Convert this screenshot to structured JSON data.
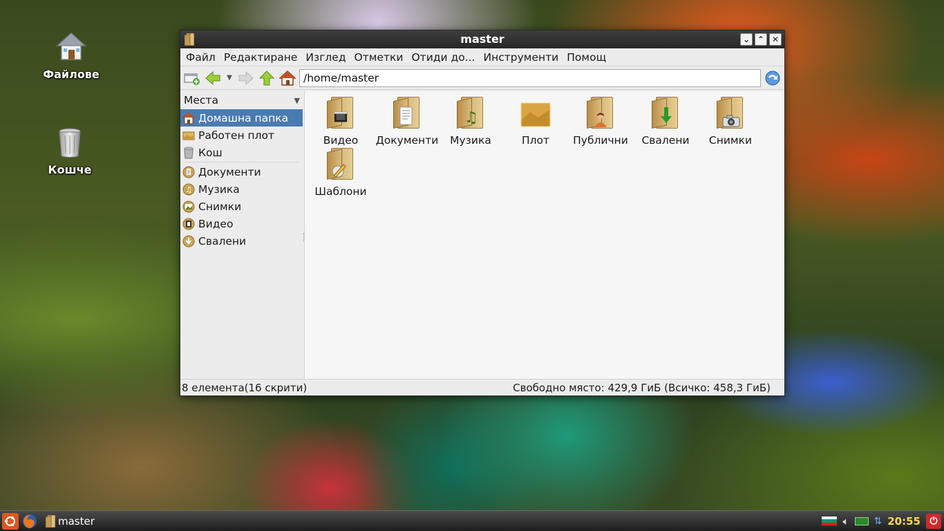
{
  "desktop": {
    "icons": [
      {
        "label": "Файлове"
      },
      {
        "label": "Кошче"
      }
    ]
  },
  "window": {
    "title": "master",
    "controls": {
      "minimize": "⌄",
      "maximize": "⌃",
      "close": "✕"
    }
  },
  "menu": [
    "Файл",
    "Редактиране",
    "Изглед",
    "Отметки",
    "Отиди до...",
    "Инструменти",
    "Помощ"
  ],
  "toolbar": {
    "address": "/home/master"
  },
  "sidebar": {
    "header": "Места",
    "items": [
      {
        "label": "Домашна папка",
        "active": true
      },
      {
        "label": "Работен плот"
      },
      {
        "label": "Кош"
      },
      {
        "label": "Документи"
      },
      {
        "label": "Музика"
      },
      {
        "label": "Снимки"
      },
      {
        "label": "Видео"
      },
      {
        "label": "Свалени"
      }
    ]
  },
  "files": [
    {
      "label": "Видео"
    },
    {
      "label": "Документи"
    },
    {
      "label": "Музика"
    },
    {
      "label": "Плот"
    },
    {
      "label": "Публични"
    },
    {
      "label": "Свалени"
    },
    {
      "label": "Снимки"
    },
    {
      "label": "Шаблони"
    }
  ],
  "status": {
    "left": "8 елемента(16 скрити)",
    "right": "Свободно място: 429,9 ГиБ (Всичко: 458,3 ГиБ)"
  },
  "taskbar": {
    "task_label": "master",
    "clock": "20:55"
  },
  "colors": {
    "accent": "#4a7bb0",
    "clock": "#ffd84a"
  }
}
